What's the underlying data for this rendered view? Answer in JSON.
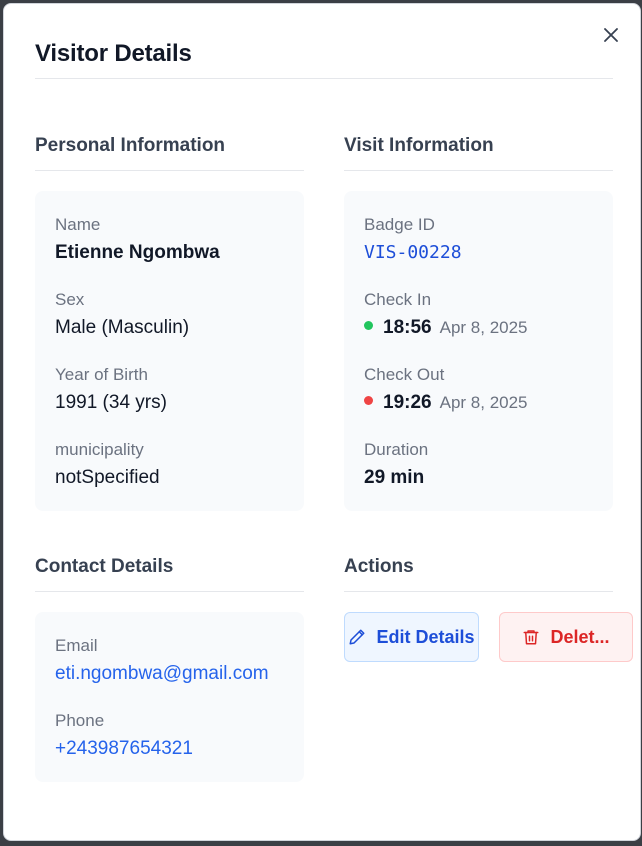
{
  "modal": {
    "title": "Visitor Details",
    "close_icon": "close-icon"
  },
  "personal": {
    "heading": "Personal Information",
    "name_label": "Name",
    "name_value": "Etienne Ngombwa",
    "sex_label": "Sex",
    "sex_value": "Male (Masculin)",
    "birth_label": "Year of Birth",
    "birth_value": "1991 (34 yrs)",
    "municipality_label": "municipality",
    "municipality_value": "notSpecified"
  },
  "visit": {
    "heading": "Visit Information",
    "badge_label": "Badge ID",
    "badge_value": "VIS-00228",
    "checkin_label": "Check In",
    "checkin_time": "18:56",
    "checkin_date": "Apr 8, 2025",
    "checkin_color": "#22c55e",
    "checkout_label": "Check Out",
    "checkout_time": "19:26",
    "checkout_date": "Apr 8, 2025",
    "checkout_color": "#ef4444",
    "duration_label": "Duration",
    "duration_value": "29 min"
  },
  "contact": {
    "heading": "Contact Details",
    "email_label": "Email",
    "email_value": "eti.ngombwa@gmail.com",
    "phone_label": "Phone",
    "phone_value": "+243987654321"
  },
  "actions": {
    "heading": "Actions",
    "edit_label": "Edit Details",
    "edit_icon": "pencil-icon",
    "delete_label": "Delet...",
    "delete_icon": "trash-icon"
  },
  "colors": {
    "primary": "#2563eb",
    "danger": "#dc2626"
  }
}
